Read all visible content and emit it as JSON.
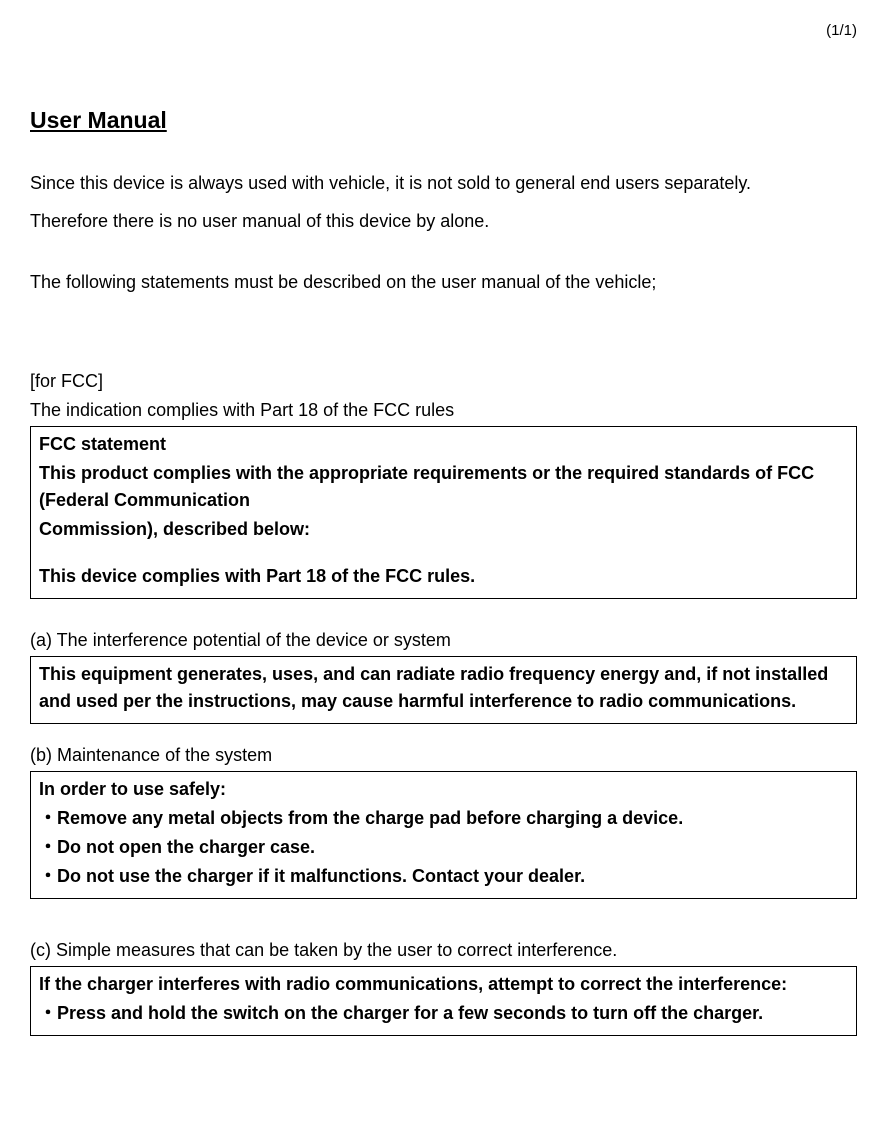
{
  "page_number": "(1/1)",
  "title": "User Manual",
  "intro": {
    "p1": "Since this device is always used with vehicle, it is not sold to general end users separately.",
    "p2": "Therefore there is no user manual of this device by alone.",
    "p3": "The following statements must be described on the user manual of the vehicle;"
  },
  "fcc": {
    "label": "[for FCC]",
    "subtitle": "The indication complies with Part 18 of the FCC rules",
    "box": {
      "h": "FCC statement",
      "l1": "This product complies with the appropriate requirements or the required standards of FCC (Federal Communication",
      "l2": "Commission), described below:",
      "l3": "This device complies with Part 18 of the FCC rules."
    }
  },
  "a": {
    "label": "(a) The interference potential of the device or system",
    "box": "This equipment generates, uses, and can radiate radio frequency energy and, if not installed and used per the instructions, may cause harmful interference to radio communications."
  },
  "b": {
    "label": "(b) Maintenance of the system",
    "box": {
      "h": "In order to use safely:",
      "b1": "・Remove any metal objects from the charge pad before charging a device.",
      "b2": "・Do not open the charger case.",
      "b3": "・Do not use the charger if it malfunctions. Contact your dealer."
    }
  },
  "c": {
    "label": "(c) Simple measures that can be taken by the user to correct interference.",
    "box": {
      "h": "If the charger interferes with radio communications, attempt to correct the interference:",
      "b1": "・Press and hold the switch on the charger for a few seconds to turn off the charger."
    }
  }
}
